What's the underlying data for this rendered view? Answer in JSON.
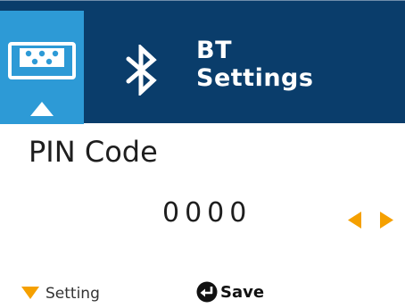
{
  "header": {
    "title_line1": "BT",
    "title_line2": "Settings",
    "background_color": "#0a3d6b",
    "tile_color": "#2d9ad6",
    "icons": [
      "printer-icon",
      "up-triangle-icon",
      "bluetooth-icon"
    ]
  },
  "field": {
    "label": "PIN Code",
    "value": "0000"
  },
  "controls": {
    "accent_color": "#f5a000",
    "icons": [
      "arrow-left-icon",
      "arrow-right-icon"
    ]
  },
  "footer": {
    "setting_label": "Setting",
    "save_label": "Save",
    "icons": [
      "down-triangle-icon",
      "enter-icon"
    ]
  }
}
